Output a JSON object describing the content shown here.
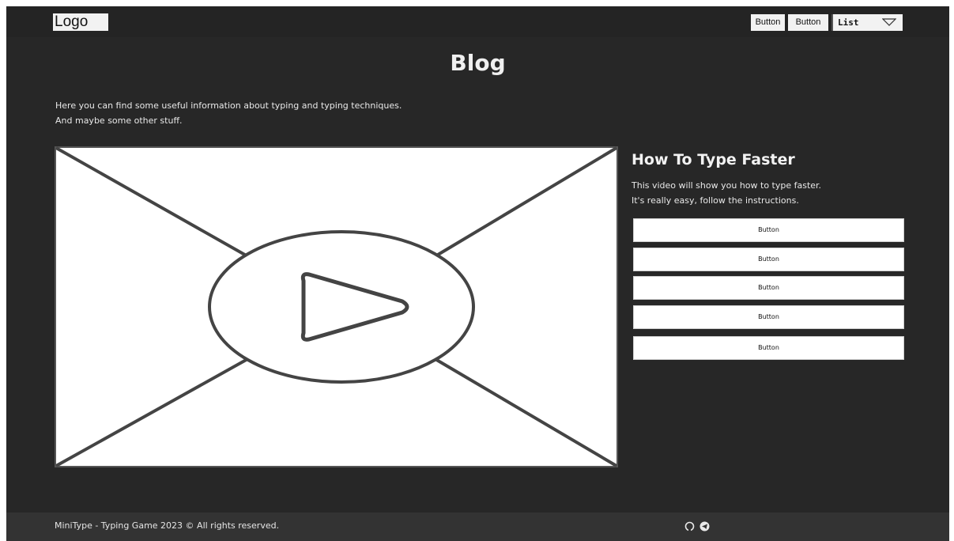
{
  "header": {
    "logo": "Logo",
    "buttons": [
      "Button",
      "Button"
    ],
    "list": {
      "selected": "List",
      "icon": "triangle-down-icon"
    }
  },
  "main": {
    "title": "Blog",
    "intro": [
      "Here you can find some useful information about typing and typing techniques.",
      "And maybe some other stuff."
    ],
    "video": {
      "icon": "play-icon"
    },
    "side": {
      "title": "How To Type Faster",
      "description": [
        "This video will show you how to type faster.",
        "It's really easy, follow the instructions."
      ],
      "buttons": [
        "Button",
        "Button",
        "Button",
        "Button",
        "Button"
      ]
    }
  },
  "footer": {
    "text": "MiniType - Typing Game 2023 © All rights reserved.",
    "icons": [
      "github-icon",
      "telegram-icon"
    ]
  },
  "colors": {
    "background": "#272727",
    "footer": "#333333",
    "text": "#f0f0f0"
  }
}
